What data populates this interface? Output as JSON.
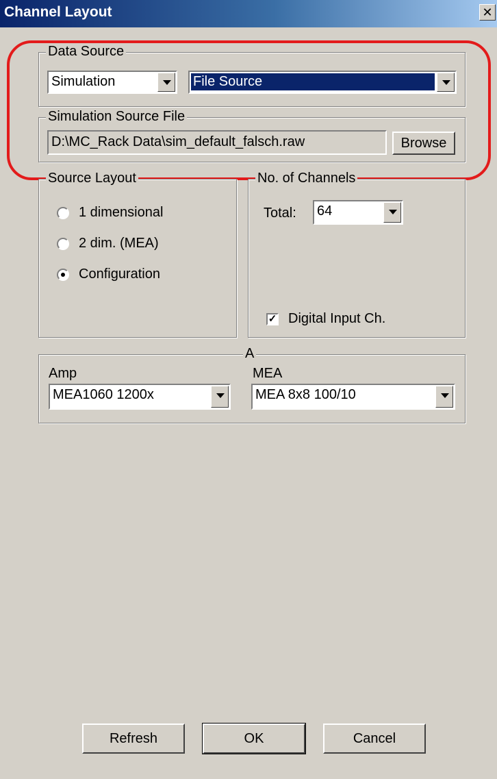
{
  "window": {
    "title": "Channel Layout",
    "close_glyph": "✕"
  },
  "data_source": {
    "label": "Data Source",
    "mode_value": "Simulation",
    "source_value": "File Source"
  },
  "sim_file": {
    "label": "Simulation Source File",
    "path": "D:\\MC_Rack Data\\sim_default_falsch.raw",
    "browse_label": "Browse"
  },
  "source_layout": {
    "label": "Source Layout",
    "options": [
      "1 dimensional",
      "2 dim. (MEA)",
      "Configuration"
    ],
    "selected_index": 2
  },
  "channels": {
    "label": "No. of Channels",
    "total_label": "Total:",
    "total_value": "64",
    "digital_input_label": "Digital Input Ch.",
    "digital_input_checked": true
  },
  "amp_group": {
    "label": "A",
    "amp_label": "Amp",
    "amp_value": "MEA1060 1200x",
    "mea_label": "MEA",
    "mea_value": "MEA 8x8 100/10"
  },
  "buttons": {
    "refresh": "Refresh",
    "ok": "OK",
    "cancel": "Cancel"
  },
  "colors": {
    "annotation_ring": "#e31b1b",
    "selection": "#0a246a",
    "dialog_bg": "#d4d0c8"
  }
}
